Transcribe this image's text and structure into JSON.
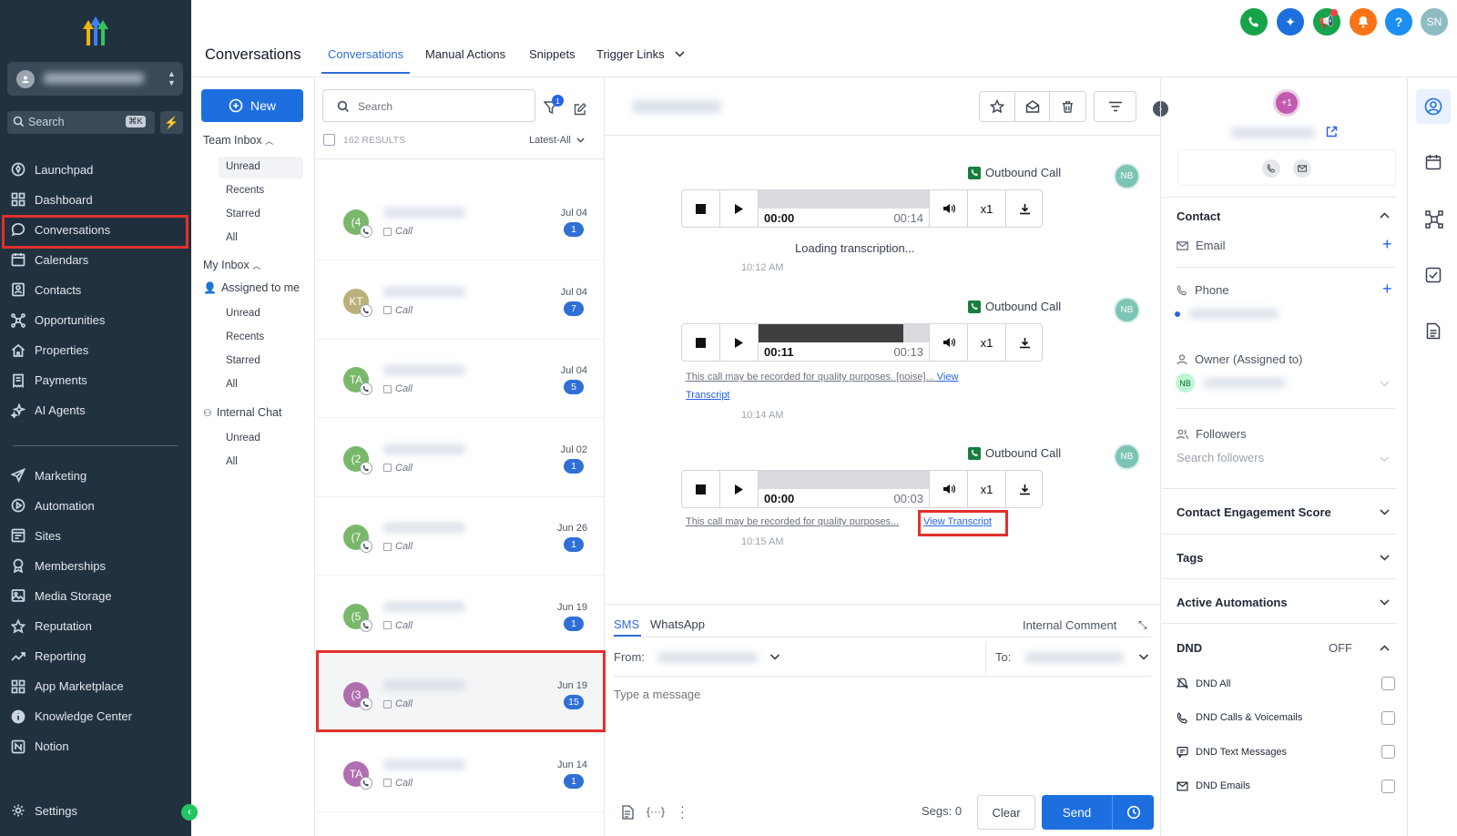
{
  "sidebar": {
    "search_placeholder": "Search",
    "shortcut": "⌘K",
    "items": [
      {
        "label": "Launchpad",
        "icon": "rocket-icon"
      },
      {
        "label": "Dashboard",
        "icon": "grid-icon"
      },
      {
        "label": "Conversations",
        "icon": "chat-icon"
      },
      {
        "label": "Calendars",
        "icon": "calendar-icon"
      },
      {
        "label": "Contacts",
        "icon": "contact-card-icon"
      },
      {
        "label": "Opportunities",
        "icon": "network-icon"
      },
      {
        "label": "Properties",
        "icon": "house-icon"
      },
      {
        "label": "Payments",
        "icon": "receipt-icon"
      },
      {
        "label": "AI Agents",
        "icon": "sparkle-icon"
      }
    ],
    "items2": [
      {
        "label": "Marketing",
        "icon": "send-icon"
      },
      {
        "label": "Automation",
        "icon": "automation-icon"
      },
      {
        "label": "Sites",
        "icon": "sites-icon"
      },
      {
        "label": "Memberships",
        "icon": "badge-icon"
      },
      {
        "label": "Media Storage",
        "icon": "image-icon"
      },
      {
        "label": "Reputation",
        "icon": "star-icon"
      },
      {
        "label": "Reporting",
        "icon": "trend-icon"
      },
      {
        "label": "App Marketplace",
        "icon": "apps-icon"
      },
      {
        "label": "Knowledge Center",
        "icon": "info-icon"
      },
      {
        "label": "Notion",
        "icon": "notion-icon"
      }
    ],
    "settings": "Settings"
  },
  "header": {
    "title": "Conversations",
    "tabs": [
      "Conversations",
      "Manual Actions",
      "Snippets",
      "Trigger Links"
    ]
  },
  "inbox": {
    "new_label": "New",
    "team_inbox": "Team Inbox",
    "team_items": [
      "Unread",
      "Recents",
      "Starred",
      "All"
    ],
    "my_inbox": "My Inbox",
    "assigned": "Assigned to me",
    "my_items": [
      "Unread",
      "Recents",
      "Starred",
      "All"
    ],
    "internal_chat": "Internal Chat",
    "chat_items": [
      "Unread",
      "All"
    ]
  },
  "list": {
    "search_placeholder": "Search",
    "filter_count": "1",
    "results": "162 RESULTS",
    "sort": "Latest-All",
    "rows": [
      {
        "initials": "(4",
        "color": "#79b86a",
        "date": "Jul 04",
        "count": "1",
        "type": "Call"
      },
      {
        "initials": "KT",
        "color": "#b9b07a",
        "date": "Jul 04",
        "count": "7",
        "type": "Call"
      },
      {
        "initials": "TA",
        "color": "#79b86a",
        "date": "Jul 04",
        "count": "5",
        "type": "Call"
      },
      {
        "initials": "(2",
        "color": "#79b86a",
        "date": "Jul 02",
        "count": "1",
        "type": "Call"
      },
      {
        "initials": "(7",
        "color": "#79b86a",
        "date": "Jun 26",
        "count": "1",
        "type": "Call"
      },
      {
        "initials": "(5",
        "color": "#79b86a",
        "date": "Jun 19",
        "count": "1",
        "type": "Call"
      },
      {
        "initials": "(3",
        "color": "#b06fae",
        "date": "Jun 19",
        "count": "15",
        "type": "Call"
      },
      {
        "initials": "TA",
        "color": "#b06fae",
        "date": "Jun 14",
        "count": "1",
        "type": "Call"
      }
    ]
  },
  "thread": {
    "calls": [
      {
        "label": "Outbound Call",
        "agent": "NB",
        "current": "00:00",
        "total": "00:14",
        "progress": 0,
        "speed": "x1",
        "status": "Loading transcription...",
        "time": "10:12 AM"
      },
      {
        "label": "Outbound Call",
        "agent": "NB",
        "current": "00:11",
        "total": "00:13",
        "progress": 0.85,
        "speed": "x1",
        "note": "This call may be recorded for quality purposes. [noise]...",
        "link_a": "View",
        "link_b": "Transcript",
        "time": "10:14 AM"
      },
      {
        "label": "Outbound Call",
        "agent": "NB",
        "current": "00:00",
        "total": "00:03",
        "progress": 0,
        "speed": "x1",
        "note": "This call may be recorded for quality purposes...",
        "link": "View Transcript",
        "time": "10:15 AM"
      }
    ]
  },
  "composer": {
    "tabs": [
      "SMS",
      "WhatsApp"
    ],
    "internal": "Internal Comment",
    "from": "From:",
    "to": "To:",
    "placeholder": "Type a message",
    "segs": "Segs: 0",
    "clear": "Clear",
    "send": "Send"
  },
  "contact": {
    "avatar": "+1",
    "sections": {
      "contact": "Contact",
      "email": "Email",
      "phone": "Phone",
      "owner": "Owner (Assigned to)",
      "owner_initials": "NB",
      "followers": "Followers",
      "followers_placeholder": "Search followers",
      "engagement": "Contact Engagement Score",
      "tags": "Tags",
      "automations": "Active Automations",
      "dnd": "DND",
      "dnd_state": "OFF"
    },
    "dnd_items": [
      {
        "label": "DND All",
        "icon": "bell-off-icon"
      },
      {
        "label": "DND Calls & Voicemails",
        "icon": "phone-icon"
      },
      {
        "label": "DND Text Messages",
        "icon": "message-icon"
      },
      {
        "label": "DND Emails",
        "icon": "mail-icon"
      }
    ]
  },
  "topbar": {
    "avatar": "SN"
  },
  "colors": {
    "sidebar": "#213140",
    "accent": "#2f6fd6",
    "send": "#1d6fe0",
    "highlight": "#e0312b"
  }
}
